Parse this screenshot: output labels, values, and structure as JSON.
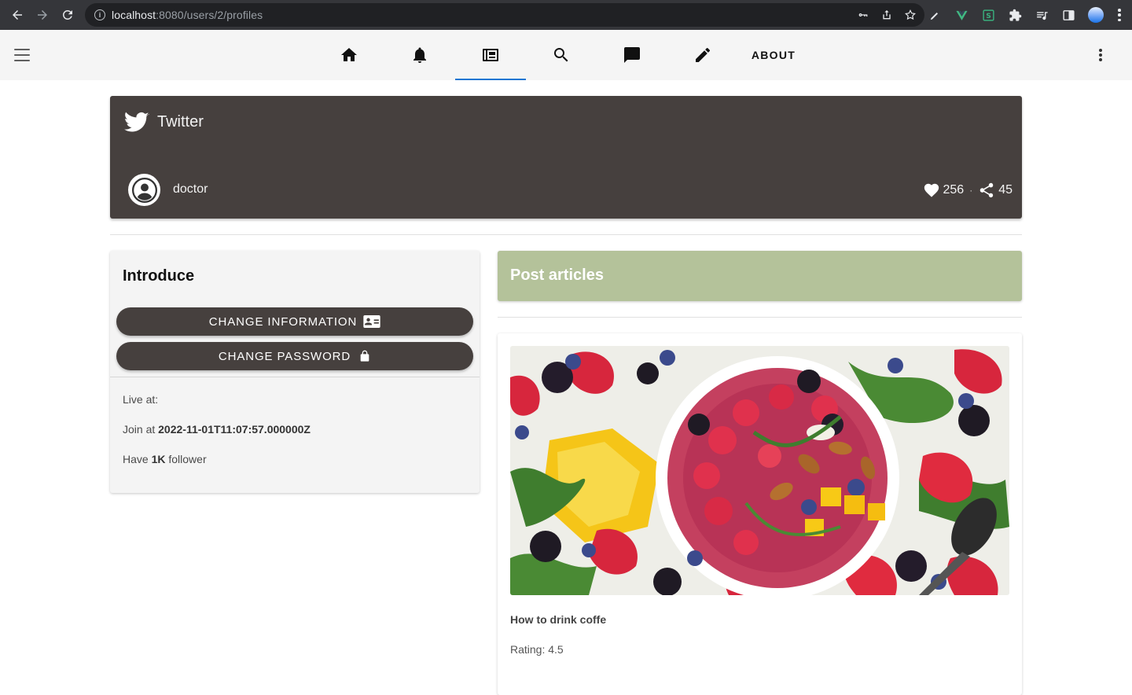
{
  "browser": {
    "url_host": "localhost",
    "url_rest": ":8080/users/2/profiles"
  },
  "appbar": {
    "tabs": [
      {
        "icon": "home-icon"
      },
      {
        "icon": "bell-icon"
      },
      {
        "icon": "newspaper-icon"
      },
      {
        "icon": "search-icon"
      },
      {
        "icon": "chat-icon"
      },
      {
        "icon": "pencil-icon"
      }
    ],
    "about_label": "ABOUT",
    "accent": "#1976d2"
  },
  "profile": {
    "title": "Twitter",
    "username": "doctor",
    "likes": "256",
    "separator": "·",
    "shares": "45",
    "bg": "#46403e"
  },
  "intro": {
    "title": "Introduce",
    "change_info_label": "CHANGE INFORMATION",
    "change_password_label": "CHANGE PASSWORD",
    "live_at_label": "Live at:",
    "join_prefix": "Join at ",
    "join_value": "2022-11-01T11:07:57.000000Z",
    "have_prefix": "Have ",
    "follower_count": "1K",
    "follower_suffix": " follower"
  },
  "posts": {
    "header": "Post articles",
    "header_color": "#b4c29a",
    "articles": [
      {
        "title": "How to drink coffe",
        "rating_label": "Rating: 4.5"
      }
    ]
  }
}
